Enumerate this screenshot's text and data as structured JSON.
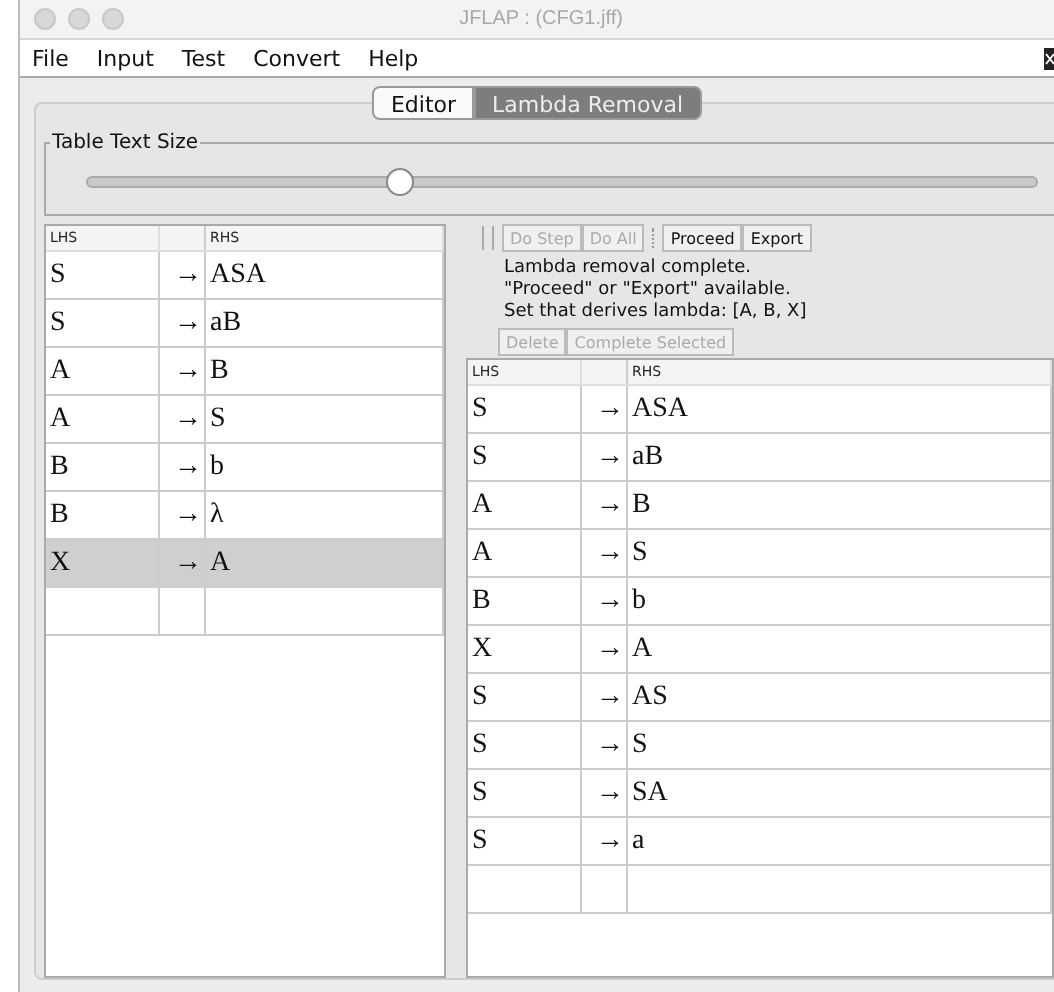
{
  "window": {
    "title": "JFLAP : (CFG1.jff)"
  },
  "menu": [
    "File",
    "Input",
    "Test",
    "Convert",
    "Help"
  ],
  "tabs": [
    {
      "label": "Editor",
      "selected": false
    },
    {
      "label": "Lambda Removal",
      "selected": true
    }
  ],
  "table_text_size": {
    "label": "Table Text Size",
    "level": 0.33
  },
  "left_table": {
    "columns": [
      "LHS",
      "RHS"
    ],
    "rows": [
      {
        "lhs": "S",
        "arrow": "→",
        "rhs": "ASA",
        "selected": false
      },
      {
        "lhs": "S",
        "arrow": "→",
        "rhs": "aB",
        "selected": false
      },
      {
        "lhs": "A",
        "arrow": "→",
        "rhs": "B",
        "selected": false
      },
      {
        "lhs": "A",
        "arrow": "→",
        "rhs": "S",
        "selected": false
      },
      {
        "lhs": "B",
        "arrow": "→",
        "rhs": "b",
        "selected": false
      },
      {
        "lhs": "B",
        "arrow": "→",
        "rhs": "λ",
        "selected": false
      },
      {
        "lhs": "X",
        "arrow": "→",
        "rhs": "A",
        "selected": true
      }
    ]
  },
  "toolbar": [
    {
      "label": "Do Step",
      "disabled": true
    },
    {
      "label": "Do All",
      "disabled": true
    },
    {
      "label": "Proceed",
      "disabled": false
    },
    {
      "label": "Export",
      "disabled": false
    }
  ],
  "messages": [
    "Lambda removal complete.",
    "\"Proceed\" or \"Export\" available.",
    "Set that derives lambda: [A, B, X]"
  ],
  "edit_buttons": [
    {
      "label": "Delete",
      "disabled": true
    },
    {
      "label": "Complete Selected",
      "disabled": true
    }
  ],
  "right_table": {
    "columns": [
      "LHS",
      "RHS"
    ],
    "rows": [
      {
        "lhs": "S",
        "arrow": "→",
        "rhs": "ASA",
        "selected": false
      },
      {
        "lhs": "S",
        "arrow": "→",
        "rhs": "aB",
        "selected": false
      },
      {
        "lhs": "A",
        "arrow": "→",
        "rhs": "B",
        "selected": false
      },
      {
        "lhs": "A",
        "arrow": "→",
        "rhs": "S",
        "selected": false
      },
      {
        "lhs": "B",
        "arrow": "→",
        "rhs": "b",
        "selected": false
      },
      {
        "lhs": "X",
        "arrow": "→",
        "rhs": "A",
        "selected": false
      },
      {
        "lhs": "S",
        "arrow": "→",
        "rhs": "AS",
        "selected": false
      },
      {
        "lhs": "S",
        "arrow": "→",
        "rhs": "S",
        "selected": false
      },
      {
        "lhs": "S",
        "arrow": "→",
        "rhs": "SA",
        "selected": false
      },
      {
        "lhs": "S",
        "arrow": "→",
        "rhs": "a",
        "selected": false
      }
    ]
  }
}
